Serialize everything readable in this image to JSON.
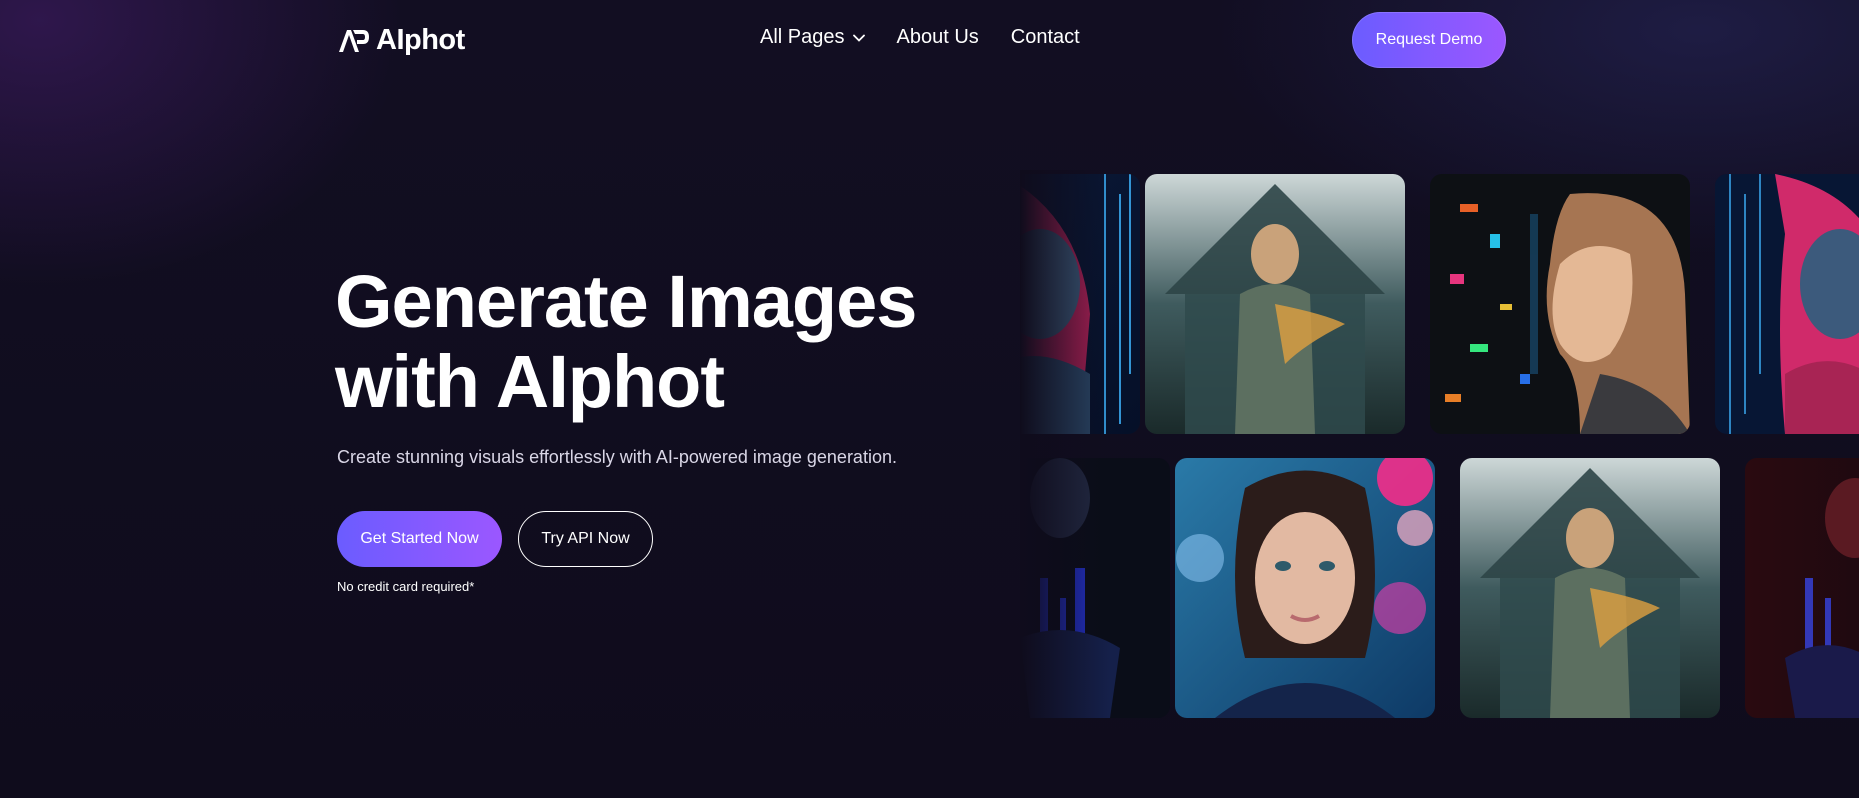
{
  "header": {
    "logo_text": "AIphot",
    "nav": [
      {
        "label": "All Pages",
        "has_dropdown": true
      },
      {
        "label": "About Us"
      },
      {
        "label": "Contact"
      }
    ],
    "cta_label": "Request Demo"
  },
  "hero": {
    "title_line1": "Generate Images",
    "title_line2": "with AIphot",
    "subtitle": "Create stunning visuals effortlessly with AI-powered image generation.",
    "primary_button": "Get Started Now",
    "secondary_button": "Try API Now",
    "fine_print": "No credit card required*"
  },
  "gallery": {
    "row1": [
      "hooded-woman-neon",
      "woman-house-double-exposure",
      "woman-profile-neon-lights",
      "hooded-woman-neon"
    ],
    "row2": [
      "woman-dark-neon",
      "woman-portrait-bokeh",
      "woman-house-double-exposure",
      "woman-red-neon"
    ]
  },
  "colors": {
    "background": "#0f0c1c",
    "accent_start": "#6b5cff",
    "accent_end": "#9b57ff",
    "text": "#ffffff"
  }
}
